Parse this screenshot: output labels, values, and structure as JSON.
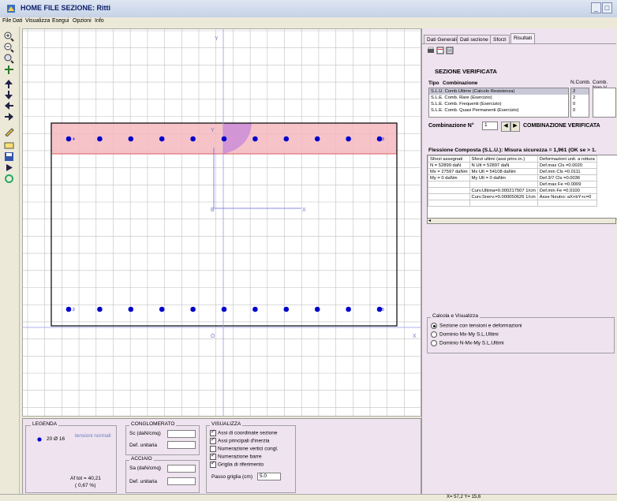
{
  "window": {
    "title": "HOME FILE SEZIONE:  Ritti",
    "controls": [
      "_",
      "□"
    ]
  },
  "menu": [
    "File",
    "Dati",
    "Visualizza",
    "Esegui",
    "Opzioni",
    "Info"
  ],
  "toolbar_icons": [
    "zoom-in-icon",
    "zoom-out-icon",
    "zoom-window-icon",
    "pan-icon",
    "arrow-up-icon",
    "arrow-down-icon",
    "arrow-left-icon",
    "arrow-right-icon",
    "pencil-icon",
    "rectangle-icon",
    "save-icon",
    "play-icon",
    "refresh-icon"
  ],
  "canvas": {
    "axis_y_top": "Y",
    "axis_y_label": "Y",
    "axis_x_label": "X",
    "barycenter_label": "B",
    "barycenter_x_label": "X",
    "origin_label": "O",
    "origin_x_label": "X",
    "colors": {
      "section_border": "#000000",
      "compressed_zone": "#f4b8c0",
      "rebar": "#0000cc",
      "grid": "#c0c0c0",
      "axis": "#9999ee"
    },
    "top_bar_count": 11,
    "bottom_bar_count": 11,
    "bar_marks_left": [
      "4",
      "2"
    ],
    "bar_marks_right": [
      "3",
      "5"
    ]
  },
  "legend": {
    "title": "LEGENDA",
    "bars": "20 Ø 16",
    "stress_label": "tensioni normali",
    "af_tot": "Af tot = 40,21",
    "af_pct": "( 0,67 %)"
  },
  "conglomerato": {
    "title": "CONGLOMERATO",
    "sc_label": "Sc (daN/cmq)",
    "sc_value": "",
    "def_label": "Def. unitaria",
    "def_value": ""
  },
  "acciaio": {
    "title": "ACCIAIO",
    "sa_label": "Sa (daN/cmq)",
    "sa_value": "",
    "def_label": "Def. unitaria",
    "def_value": ""
  },
  "visualizza": {
    "title": "VISUALIZZA",
    "options": [
      {
        "label": "Assi di coordinate sezione",
        "checked": true
      },
      {
        "label": "Assi principali d'inerzia",
        "checked": true
      },
      {
        "label": "Numerazione vertici congl.",
        "checked": false
      },
      {
        "label": "Numerazione barre",
        "checked": true
      },
      {
        "label": "Griglia di riferimento",
        "checked": true
      }
    ],
    "passo_label": "Passo griglia (cm)",
    "passo_value": "5.0"
  },
  "tabs": [
    "Dati Generali",
    "Dati sezione",
    "Sforzi",
    "Risultati"
  ],
  "results": {
    "heading": "SEZIONE VERIFICATA",
    "tipo_label": "Tipo",
    "combinazione_label": "Combinazione",
    "ncomb_label": "N.Comb.",
    "combnon_label": "Comb. Non V.",
    "combinations": [
      {
        "name": "S.L.U. Comb.Ultime (Calcolo Resistenza)",
        "n": "2"
      },
      {
        "name": "S.L.E. Comb. Rare (Esercizio)",
        "n": "2"
      },
      {
        "name": "S.L.E. Comb. Frequenti (Esercizio)",
        "n": "0"
      },
      {
        "name": "S.L.E. Comb. Quasi Permanenti (Esercizio)",
        "n": "0"
      }
    ],
    "comb_n_label": "Combinazione N°",
    "comb_n_value": "1",
    "comb_status": "COMBINAZIONE VERIFICATA",
    "flex_title": "Flessione Composta (S.L.U.): Misura sicurezza = 1,961 (OK se > 1.",
    "table_headers": [
      "Sforzi assegnati",
      "Sforzi ultimi (assi princ.in.)",
      "Deformazioni unit. a rottura"
    ],
    "table_rows": [
      [
        "N = 52899 daN",
        "N Ult = 52897 daN",
        "Def.max Cls =0.0020"
      ],
      [
        "Mx = 27597 daNm",
        "Mx Ult = 54108 daNm",
        "Def.min Cls =0.0111"
      ],
      [
        "My = 0 daNm",
        "My Ult = 0 daNm",
        "Def.3/7 Cls =0.0036"
      ],
      [
        "",
        "",
        "Def.max Fe =0.0009"
      ],
      [
        "",
        "Curv.Ultima=0.000217507 1/cm",
        "Def.min Fe =0.0100"
      ],
      [
        "",
        "Curv.Snerv.=0.000050626 1/cm",
        "Asse Neutro: aX+bY+c=0"
      ],
      [
        "",
        "",
        ""
      ]
    ]
  },
  "calcola": {
    "title": "Calcola e Visualizza",
    "options": [
      {
        "label": "Sezione con tensioni e deformazioni",
        "selected": true
      },
      {
        "label": "Dominio Mx-My S.L.Ultimi",
        "selected": false
      },
      {
        "label": "Dominio N-Mx-My S.L.Ultimi",
        "selected": false
      }
    ]
  },
  "status": {
    "coords": "X= 57,2   Y= 15,6"
  }
}
